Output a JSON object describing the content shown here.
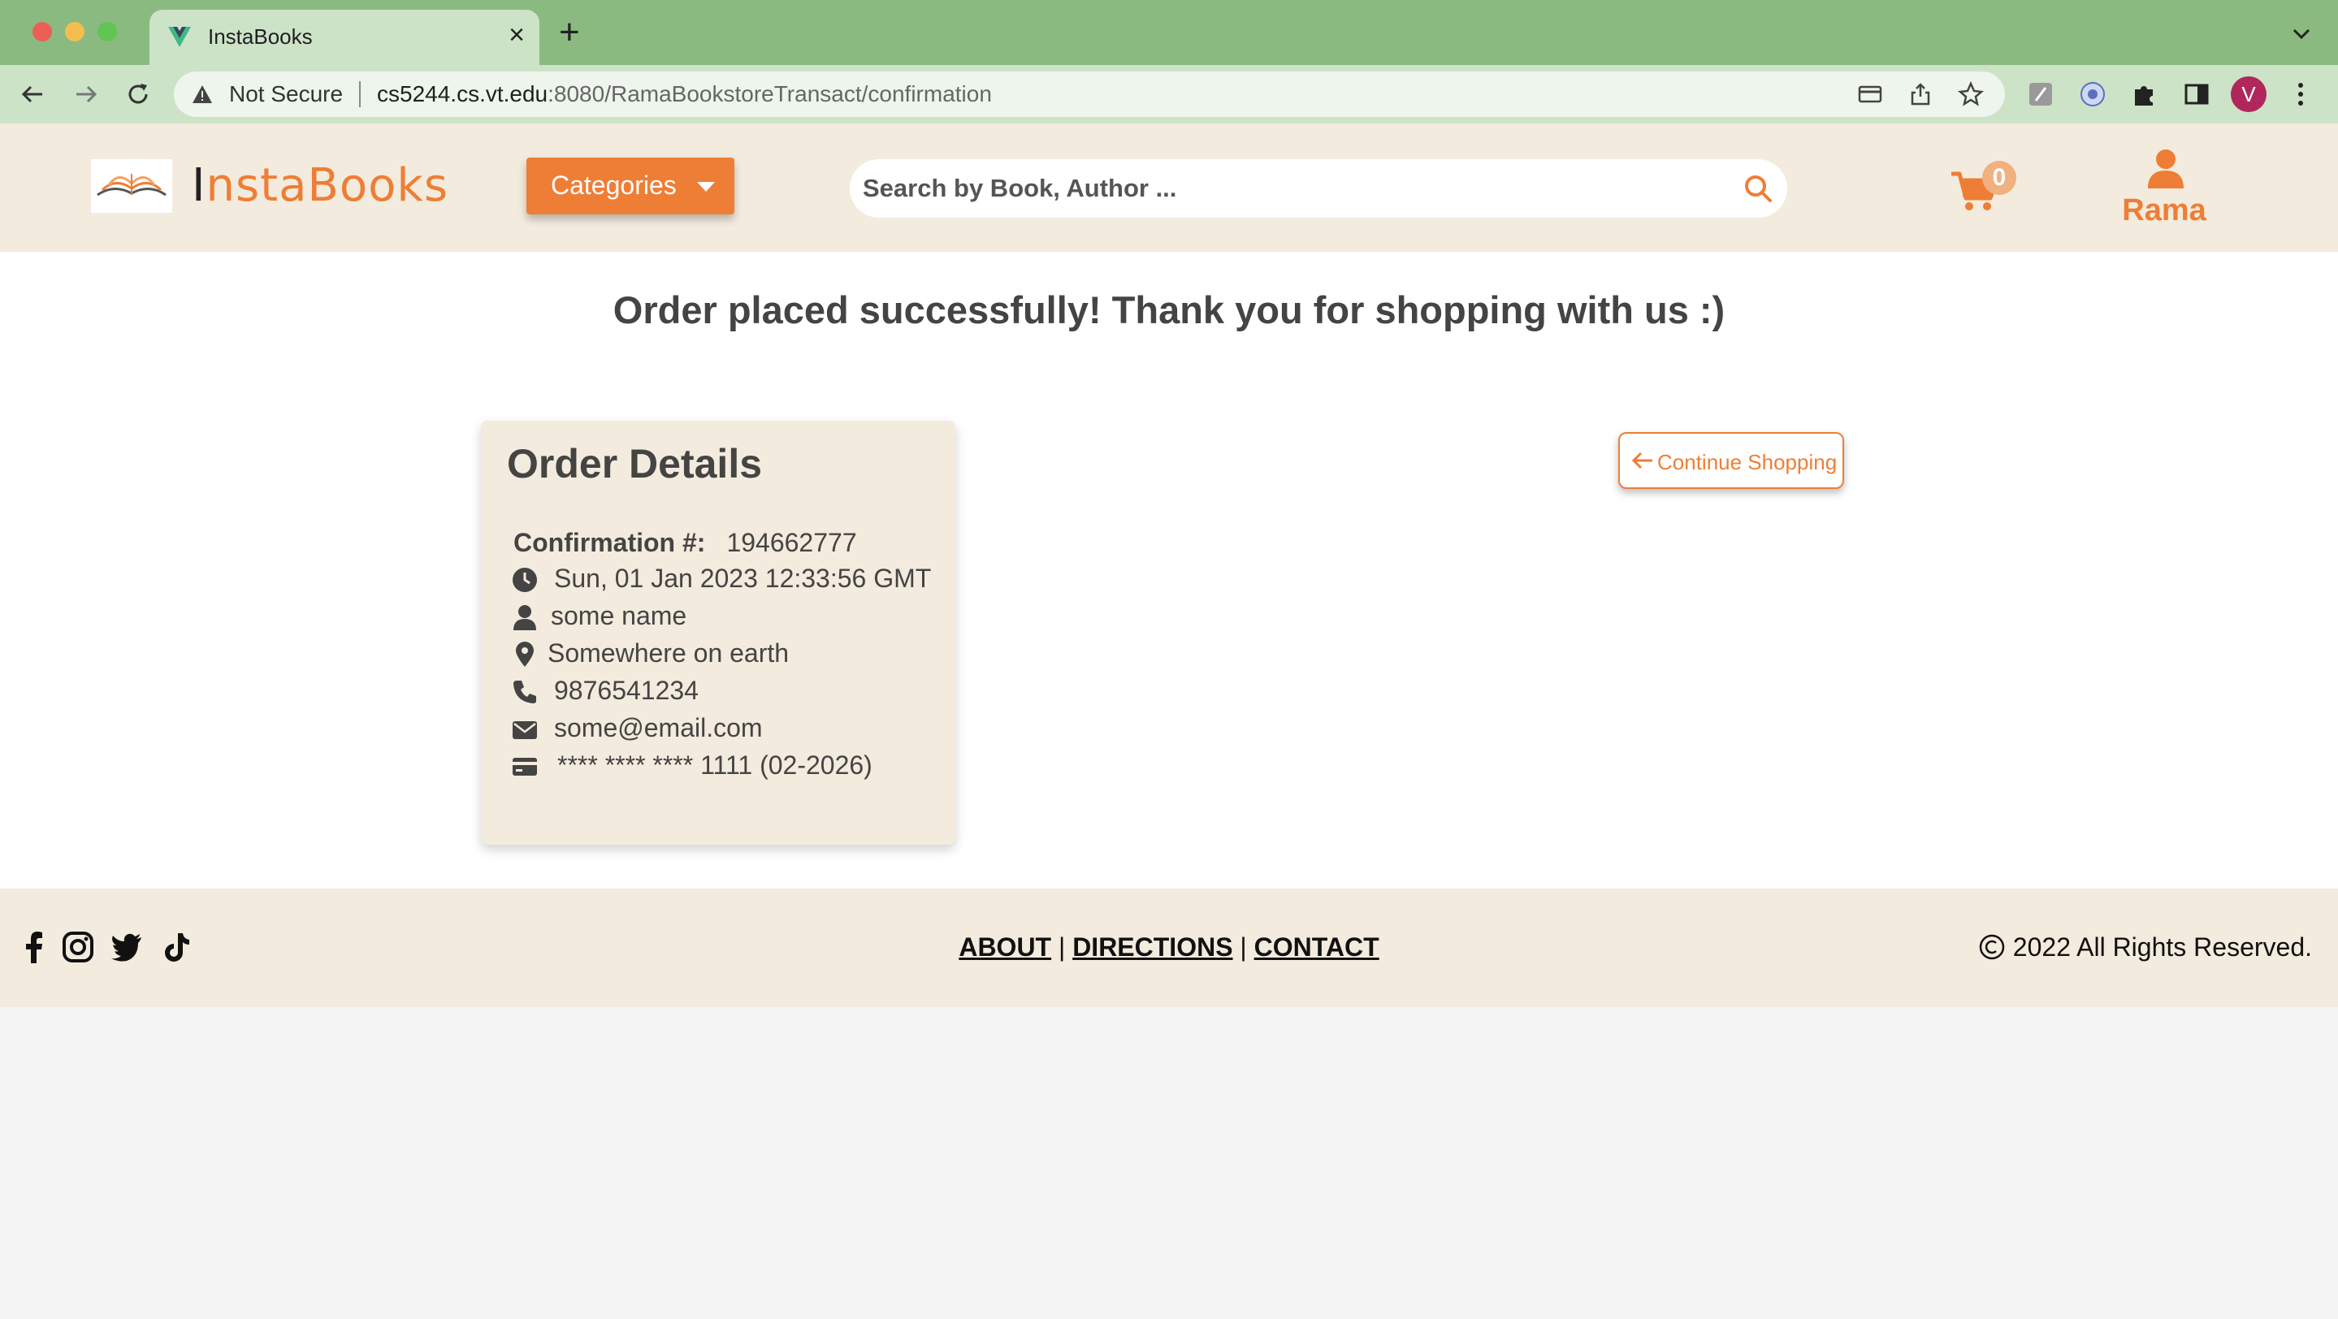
{
  "browser": {
    "tab_title": "InstaBooks",
    "security_label": "Not Secure",
    "url_host": "cs5244.cs.vt.edu",
    "url_path": ":8080/RamaBookstoreTransact/confirmation",
    "profile_initial": "V"
  },
  "header": {
    "logo_first_letter": "I",
    "logo_rest": "nstaBooks",
    "categories_label": "Categories",
    "search_placeholder": "Search by Book, Author ...",
    "cart_count": "0",
    "user_name": "Rama"
  },
  "main": {
    "success_message": "Order placed successfully! Thank you for shopping with us :)",
    "continue_label": "Continue Shopping",
    "order": {
      "title": "Order Details",
      "confirmation_label": "Confirmation #:",
      "confirmation_number": "194662777",
      "date": "Sun, 01 Jan 2023 12:33:56 GMT",
      "name": "some name",
      "address": "Somewhere on earth",
      "phone": "9876541234",
      "email": "some@email.com",
      "card": "**** **** **** 1111 (02-2026)"
    }
  },
  "footer": {
    "links": [
      "ABOUT",
      "DIRECTIONS",
      "CONTACT"
    ],
    "separator": "|",
    "copyright": "2022 All Rights Reserved."
  },
  "colors": {
    "accent": "#ee7e35",
    "header_bg": "#f3ebdd",
    "browser_frame": "#8aba80"
  }
}
